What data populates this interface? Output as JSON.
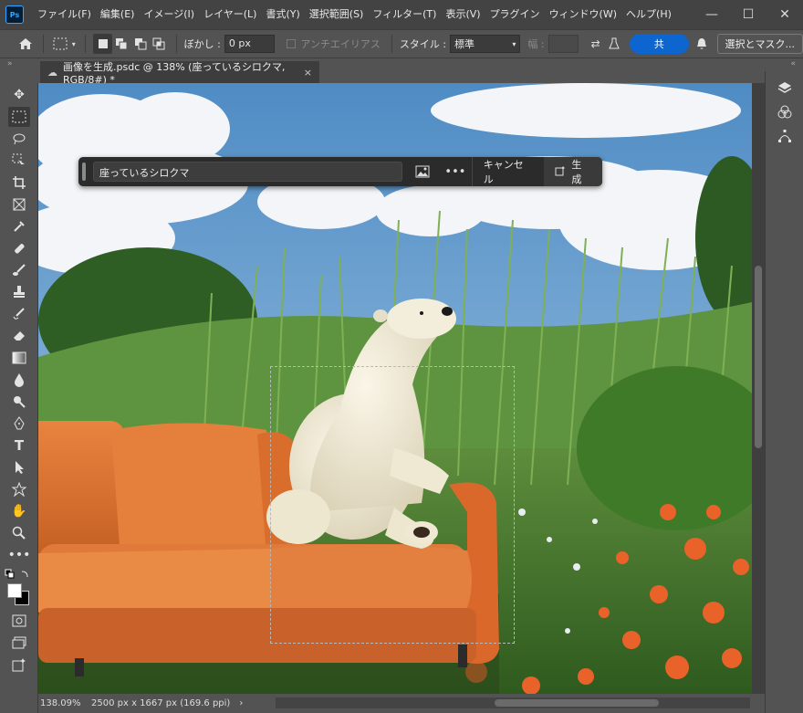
{
  "app": {
    "logo_text": "Ps"
  },
  "menu": [
    "ファイル(F)",
    "編集(E)",
    "イメージ(I)",
    "レイヤー(L)",
    "書式(Y)",
    "選択範囲(S)",
    "フィルター(T)",
    "表示(V)",
    "プラグイン",
    "ウィンドウ(W)",
    "ヘルプ(H)"
  ],
  "window_controls": {
    "minimize": "—",
    "maximize": "☐",
    "close": "✕"
  },
  "options": {
    "feather_label": "ぼかし :",
    "feather_value": "0 px",
    "antialias_label": "アンチエイリアス",
    "style_label": "スタイル :",
    "style_value": "標準",
    "width_label": "幅 :",
    "share_label": "共",
    "select_mask_label": "選択とマスク..."
  },
  "document": {
    "tab_title": "画像を生成.psdc @ 138% (座っているシロクマ, RGB/8#) *",
    "close": "×"
  },
  "taskbar": {
    "prompt": "座っているシロクマ",
    "more": "•••",
    "cancel": "キャンセル",
    "generate": "生成"
  },
  "status": {
    "zoom": "138.09%",
    "doc_info": "2500 px x 1667 px (169.6 ppi)",
    "arrow": "›"
  },
  "colors": {
    "accent": "#0d66d0",
    "sofa": "#e07a3a",
    "sky": "#6fa7d6",
    "grass": "#4f8a30"
  }
}
